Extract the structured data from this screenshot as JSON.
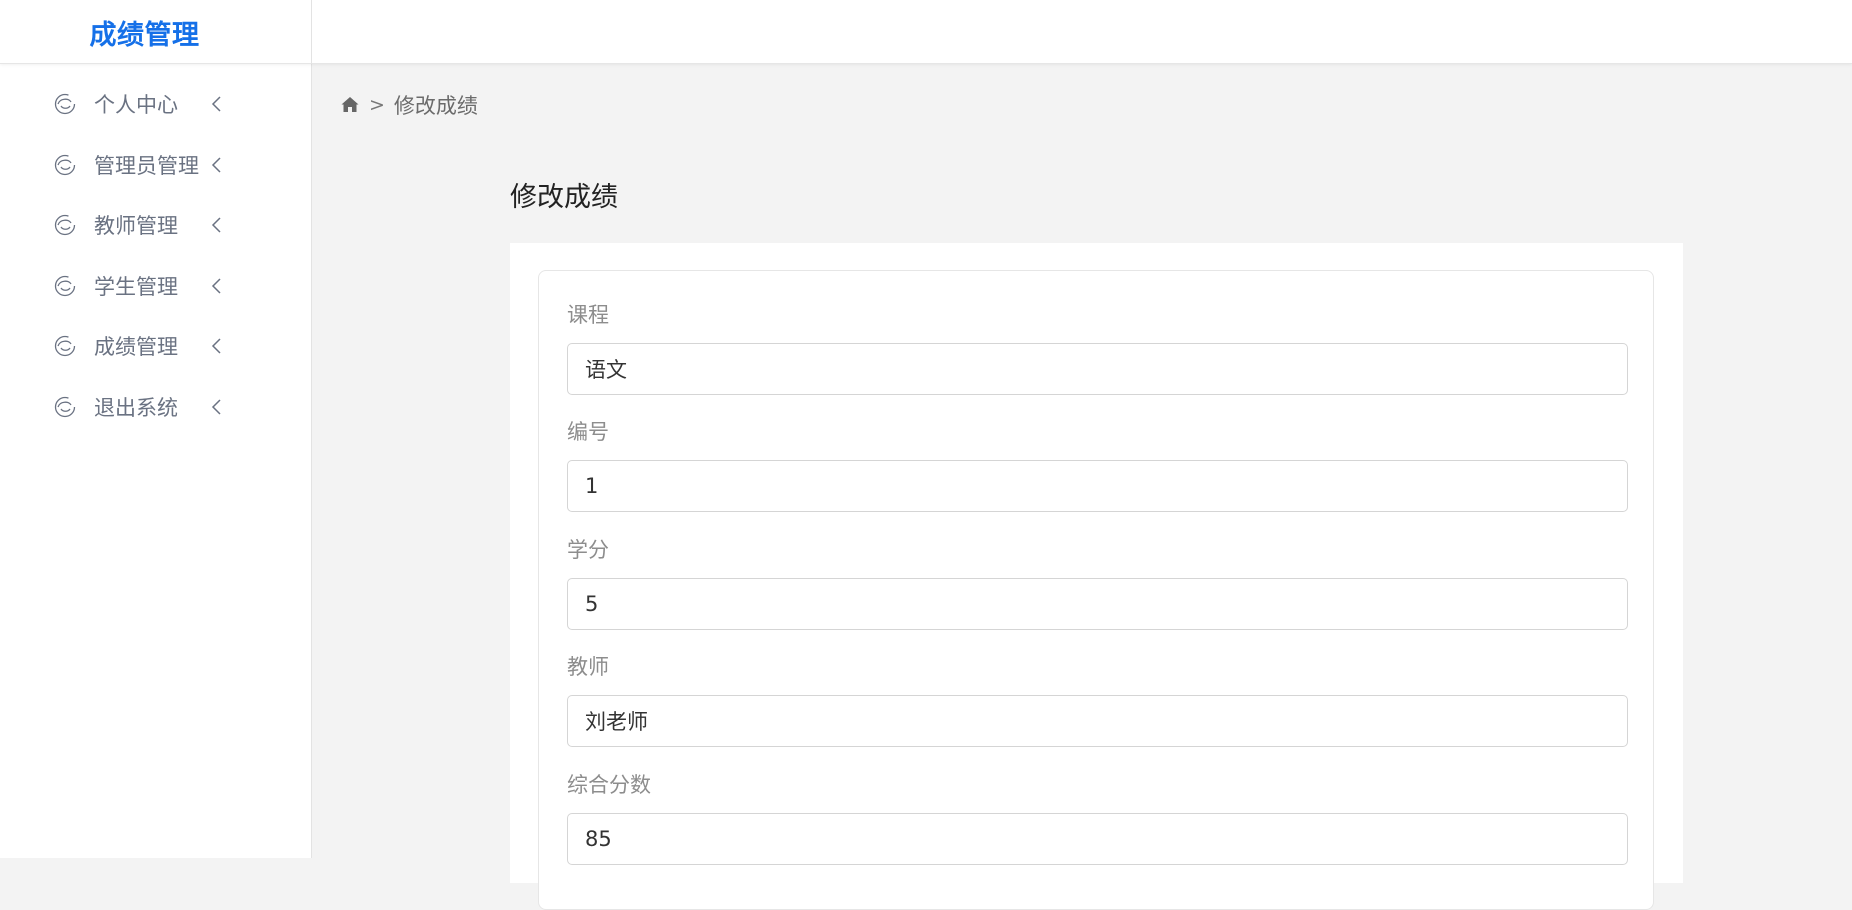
{
  "header": {
    "brand_title": "成绩管理"
  },
  "sidebar": {
    "items": [
      {
        "label": "个人中心",
        "icon": "swirl-icon"
      },
      {
        "label": "管理员管理",
        "icon": "swirl-icon"
      },
      {
        "label": "教师管理",
        "icon": "swirl-icon"
      },
      {
        "label": "学生管理",
        "icon": "swirl-icon"
      },
      {
        "label": "成绩管理",
        "icon": "swirl-icon"
      },
      {
        "label": "退出系统",
        "icon": "swirl-icon"
      }
    ]
  },
  "breadcrumb": {
    "separator": ">",
    "current": "修改成绩"
  },
  "page": {
    "title": "修改成绩"
  },
  "form": {
    "fields": [
      {
        "label": "课程",
        "value": "语文"
      },
      {
        "label": "编号",
        "value": "1"
      },
      {
        "label": "学分",
        "value": "5"
      },
      {
        "label": "教师",
        "value": "刘老师"
      },
      {
        "label": "综合分数",
        "value": "85"
      }
    ]
  },
  "colors": {
    "brand": "#1570e8",
    "nav_text": "#6a7282",
    "background": "#f3f3f3"
  }
}
